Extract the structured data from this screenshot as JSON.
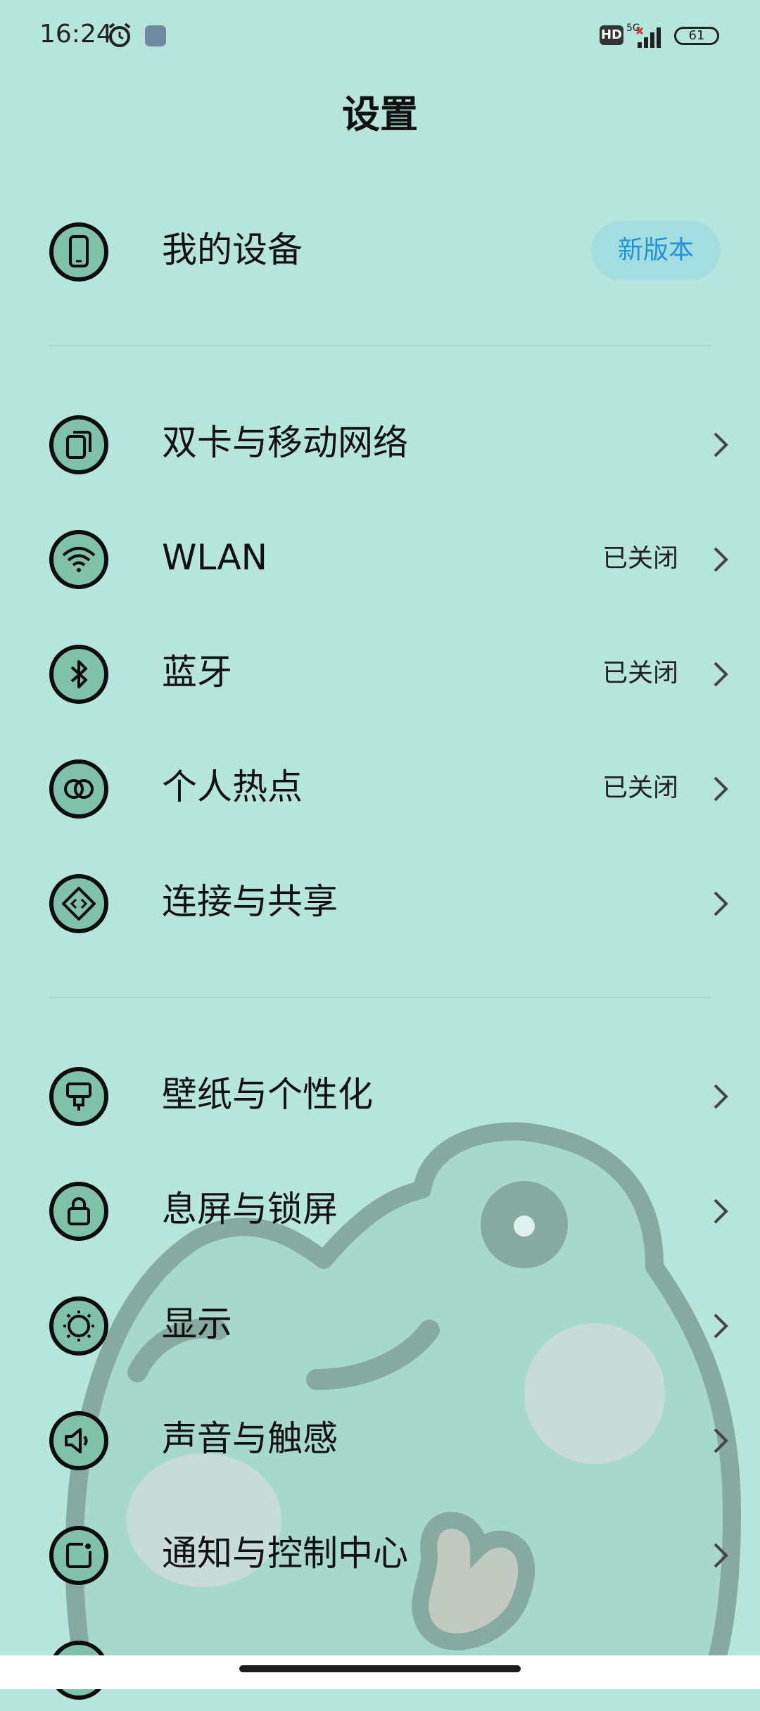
{
  "status_bar": {
    "time": "16:24",
    "network": "5G",
    "hd_label": "HD",
    "battery": "61"
  },
  "title": "设置",
  "my_device": {
    "label": "我的设备",
    "badge": "新版本"
  },
  "network_section": [
    {
      "label": "双卡与移动网络",
      "status": "",
      "icon": "dual-sim-icon"
    },
    {
      "label": "WLAN",
      "status": "已关闭",
      "icon": "wifi-icon"
    },
    {
      "label": "蓝牙",
      "status": "已关闭",
      "icon": "bluetooth-icon"
    },
    {
      "label": "个人热点",
      "status": "已关闭",
      "icon": "hotspot-icon"
    },
    {
      "label": "连接与共享",
      "status": "",
      "icon": "share-icon"
    }
  ],
  "personal_section": [
    {
      "label": "壁纸与个性化",
      "icon": "brush-icon"
    },
    {
      "label": "息屏与锁屏",
      "icon": "lock-icon"
    },
    {
      "label": "显示",
      "icon": "brightness-icon"
    },
    {
      "label": "声音与触感",
      "icon": "speaker-icon"
    },
    {
      "label": "通知与控制中心",
      "icon": "notification-icon"
    }
  ],
  "colors": {
    "background": "#b6e5dc",
    "icon_fill": "#7fc1a9",
    "badge_bg": "#a4dde0",
    "badge_text": "#1e93d8"
  }
}
